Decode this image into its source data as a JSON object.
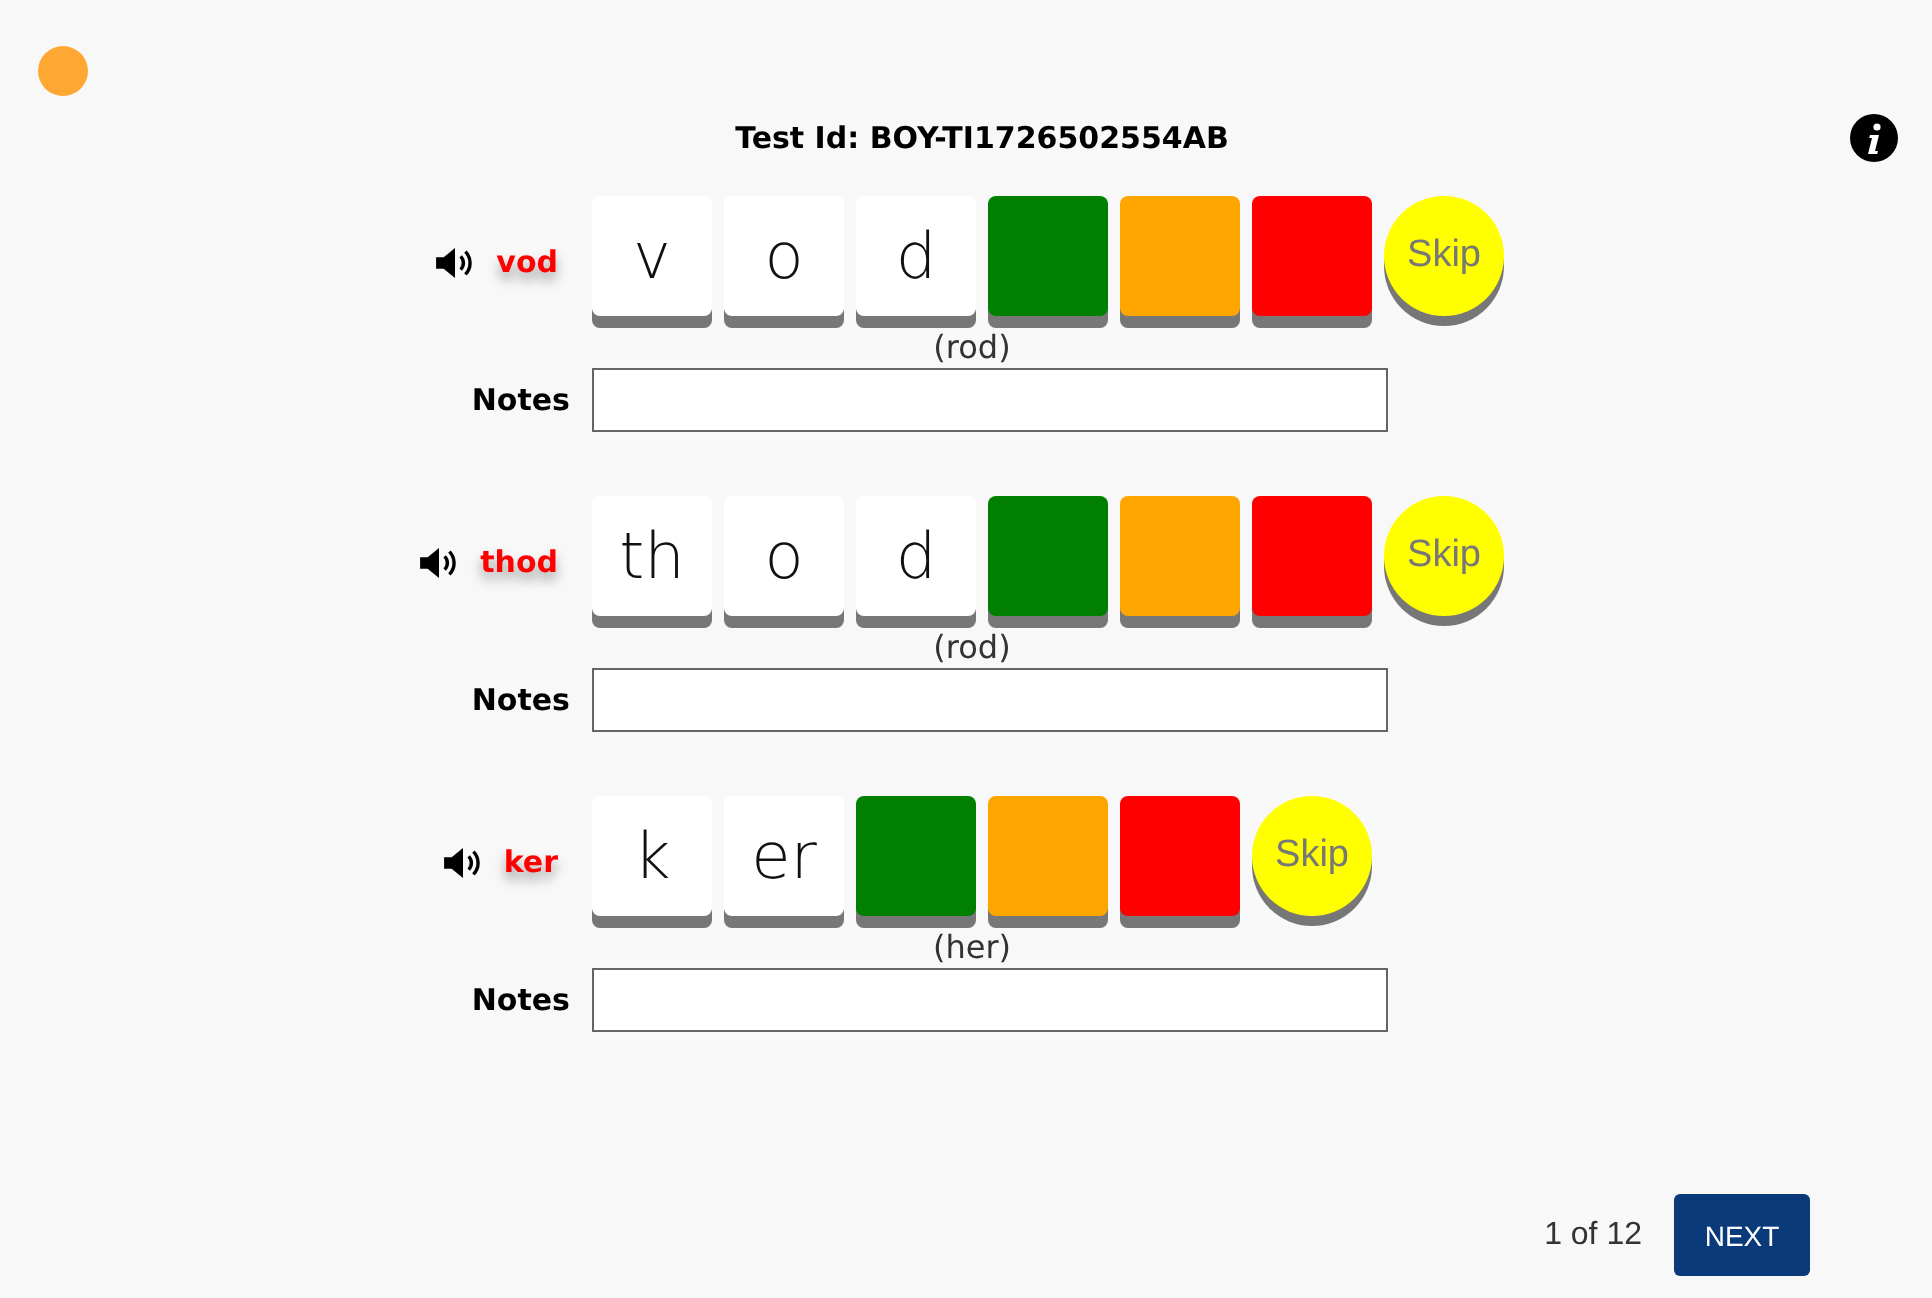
{
  "status_dot": {
    "color": "#ffa733"
  },
  "title": "Test Id: BOY-TI1726502554AB",
  "items": [
    {
      "word": "vod",
      "tiles": [
        {
          "kind": "letter",
          "text": "v"
        },
        {
          "kind": "letter",
          "text": "o"
        },
        {
          "kind": "letter",
          "text": "d"
        },
        {
          "kind": "rating",
          "color": "#008000"
        },
        {
          "kind": "rating",
          "color": "#ffa500"
        },
        {
          "kind": "rating",
          "color": "#ff0000"
        }
      ],
      "skip": "Skip",
      "hint": "(rod)",
      "notes_label": "Notes"
    },
    {
      "word": "thod",
      "tiles": [
        {
          "kind": "letter",
          "text": "th"
        },
        {
          "kind": "letter",
          "text": "o"
        },
        {
          "kind": "letter",
          "text": "d"
        },
        {
          "kind": "rating",
          "color": "#008000"
        },
        {
          "kind": "rating",
          "color": "#ffa500"
        },
        {
          "kind": "rating",
          "color": "#ff0000"
        }
      ],
      "skip": "Skip",
      "hint": "(rod)",
      "notes_label": "Notes"
    },
    {
      "word": "ker",
      "tiles": [
        {
          "kind": "letter",
          "text": "k"
        },
        {
          "kind": "letter",
          "text": "er"
        },
        {
          "kind": "rating",
          "color": "#008000"
        },
        {
          "kind": "rating",
          "color": "#ffa500"
        },
        {
          "kind": "rating",
          "color": "#ff0000"
        }
      ],
      "skip": "Skip",
      "hint": "(her)",
      "notes_label": "Notes"
    }
  ],
  "pager": {
    "text": "1 of 12",
    "button": "NEXT"
  }
}
